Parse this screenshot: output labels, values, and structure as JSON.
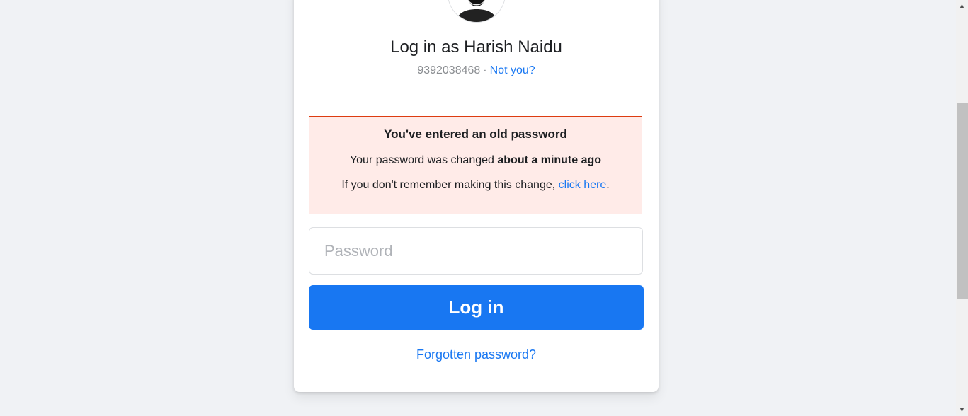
{
  "profile": {
    "title": "Log in as Harish Naidu",
    "phone": "9392038468",
    "separator": "·",
    "not_you": "Not you?"
  },
  "alert": {
    "title": "You've entered an old password",
    "line1_prefix": "Your password was changed ",
    "line1_bold": "about a minute ago",
    "line2_prefix": "If you don't remember making this change, ",
    "line2_link": "click here",
    "line2_suffix": "."
  },
  "form": {
    "password_placeholder": "Password",
    "login_label": "Log in",
    "forgot_label": "Forgotten password?"
  },
  "scrollbar": {
    "up_icon": "▲",
    "down_icon": "▼"
  },
  "colors": {
    "brand": "#1877f2",
    "alert_bg": "#ffebe8",
    "alert_border": "#dd3c10",
    "page_bg": "#f0f2f5"
  }
}
